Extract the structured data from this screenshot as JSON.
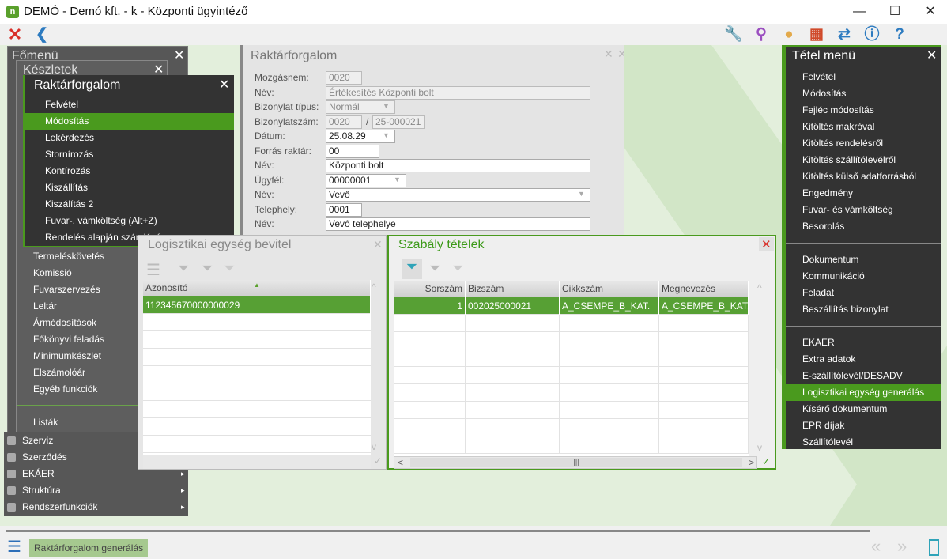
{
  "window": {
    "title": "DEMÓ - Demó kft. - k - Központi ügyintéző",
    "logo": "n",
    "minimize": "—",
    "maximize": "☐",
    "close": "✕"
  },
  "toolbar": {
    "close_icon": "✕",
    "back_icon": "❮",
    "tools": [
      {
        "icon": "wrench-icon",
        "glyph": "🔧",
        "color": "#2e9a6e"
      },
      {
        "icon": "search-icon",
        "glyph": "⚲",
        "color": "#9b4fc0"
      },
      {
        "icon": "user-icon",
        "glyph": "●",
        "color": "#e3a94a"
      },
      {
        "icon": "apps-icon",
        "glyph": "▦",
        "color": "#d04a2a"
      },
      {
        "icon": "swap-icon",
        "glyph": "⇄",
        "color": "#2d7bc0"
      },
      {
        "icon": "info-icon",
        "glyph": "ⓘ",
        "color": "#2d7bc0"
      },
      {
        "icon": "help-icon",
        "glyph": "?",
        "color": "#2d7bc0"
      }
    ]
  },
  "fomenu": {
    "title": "Főmenü",
    "items": [
      "Termeléskövetés",
      "Komissió",
      "Fuvarszervezés",
      "Leltár",
      "Ármódosítások",
      "Főkönyvi feladás",
      "Minimumkészlet",
      "Elszámolóár",
      "Egyéb funkciók",
      "Listák"
    ],
    "bottom_items": [
      {
        "label": "Szerviz",
        "arrow": ""
      },
      {
        "label": "Szerződés",
        "arrow": ""
      },
      {
        "label": "EKÁER",
        "arrow": "▸"
      },
      {
        "label": "Struktúra",
        "arrow": "▸"
      },
      {
        "label": "Rendszerfunkciók",
        "arrow": "▸"
      }
    ]
  },
  "keszletek": {
    "title": "Készletek"
  },
  "rf_menu": {
    "title": "Raktárforgalom",
    "items": [
      "Felvétel",
      "Módosítás",
      "Lekérdezés",
      "Stornírozás",
      "Kontírozás",
      "Kiszállítás",
      "Kiszálítás 2",
      "Fuvar-, vámköltség (Alt+Z)",
      "Rendelés alapján számlázás"
    ],
    "selected": 1
  },
  "form": {
    "title": "Raktárforgalom",
    "fields": [
      {
        "label": "Mozgásnem:",
        "value": "0020"
      },
      {
        "label": "Név:",
        "value": "Értékesítés Központi bolt"
      },
      {
        "label": "Bizonylat típus:",
        "value": "Normál"
      },
      {
        "label": "Bizonylatszám:",
        "value": "0020",
        "sep": "/",
        "value2": "25-000021"
      },
      {
        "label": "Dátum:",
        "value": "25.08.29"
      },
      {
        "label": "Forrás raktár:",
        "value": "00"
      },
      {
        "label": "Név:",
        "value": "Központi bolt"
      },
      {
        "label": "Ügyfél:",
        "value": "00000001"
      },
      {
        "label": "Név:",
        "value": "Vevő"
      },
      {
        "label": "Telephely:",
        "value": "0001"
      },
      {
        "label": "Név:",
        "value": "Vevő telephelye"
      }
    ]
  },
  "logi": {
    "title": "Logisztikai egység bevitel",
    "column": "Azonosító",
    "rows": [
      "112345670000000029"
    ]
  },
  "szabaly": {
    "title": "Szabály tételek",
    "columns": [
      "Sorszám",
      "Bizszám",
      "Cikkszám",
      "Megnevezés"
    ],
    "rows": [
      [
        "1",
        "002025000021",
        "A_CSEMPE_B_KAT.",
        "A_CSEMPE_B_KAT."
      ]
    ]
  },
  "tetel": {
    "title": "Tétel menü",
    "groups": [
      [
        "Felvétel",
        "Módosítás",
        "Fejléc módosítás",
        "Kitöltés makróval",
        "Kitöltés rendelésről",
        "Kitöltés szállítólevélről",
        "Kitöltés külső adatforrásból",
        "Engedmény",
        "Fuvar- és vámköltség",
        "Besorolás"
      ],
      [
        "Dokumentum",
        "Kommunikáció",
        "Feladat",
        "Beszállítás bizonylat"
      ],
      [
        "EKAER",
        "Extra adatok",
        "E-szállítólevél/DESADV",
        "Logisztikai egység generálás",
        "Kísérő dokumentum",
        "EPR díjak",
        "Szállítólevél"
      ]
    ],
    "selected": "Logisztikai egység generálás"
  },
  "status": {
    "chip": "Raktárforgalom generálás"
  }
}
